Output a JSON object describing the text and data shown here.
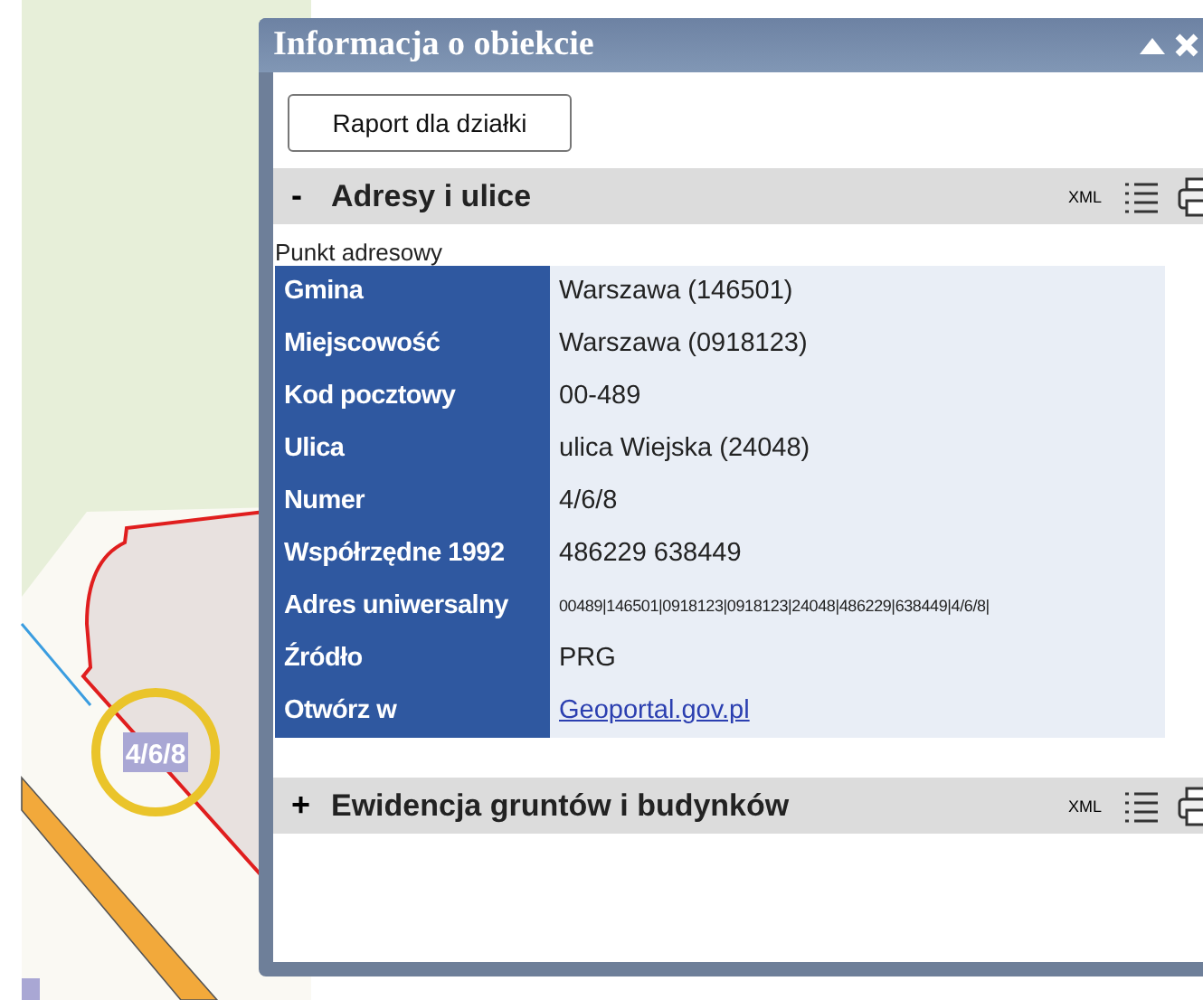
{
  "map": {
    "parcel_label": "4/6/8"
  },
  "window": {
    "title": "Informacja o obiekcie"
  },
  "report_button": "Raport dla działki",
  "sections": [
    {
      "toggle": "-",
      "title": "Adresy i ulice",
      "xml": "XML",
      "subtitle": "Punkt adresowy",
      "rows": [
        {
          "label": "Gmina",
          "value": "Warszawa (146501)",
          "kind": "text"
        },
        {
          "label": "Miejscowość",
          "value": "Warszawa (0918123)",
          "kind": "text"
        },
        {
          "label": "Kod pocztowy",
          "value": "00-489",
          "kind": "text"
        },
        {
          "label": "Ulica",
          "value": "ulica Wiejska (24048)",
          "kind": "text"
        },
        {
          "label": "Numer",
          "value": "4/6/8",
          "kind": "text"
        },
        {
          "label": "Współrzędne 1992",
          "value": "486229 638449",
          "kind": "text"
        },
        {
          "label": "Adres uniwersalny",
          "value": "00489|146501|0918123|0918123|24048|486229|638449|4/6/8|",
          "kind": "small"
        },
        {
          "label": "Źródło",
          "value": "PRG",
          "kind": "text"
        },
        {
          "label": "Otwórz w",
          "value": "Geoportal.gov.pl",
          "kind": "link"
        }
      ]
    },
    {
      "toggle": "+",
      "title": "Ewidencja gruntów i budynków",
      "xml": "XML"
    }
  ]
}
